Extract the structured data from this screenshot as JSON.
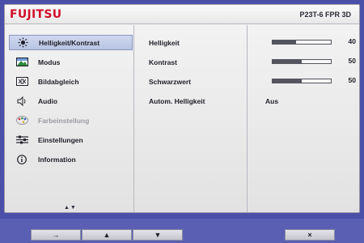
{
  "header": {
    "logo": "FUJITSU",
    "model": "P23T-6 FPR 3D"
  },
  "menu": {
    "items": [
      {
        "label": "Helligkeit/Kontrast",
        "icon": "sun-icon",
        "selected": true,
        "disabled": false
      },
      {
        "label": "Modus",
        "icon": "picture-mode-icon",
        "selected": false,
        "disabled": false
      },
      {
        "label": "Bildabgleich",
        "icon": "image-adjust-icon",
        "selected": false,
        "disabled": false
      },
      {
        "label": "Audio",
        "icon": "speaker-icon",
        "selected": false,
        "disabled": false
      },
      {
        "label": "Farbeinstellung",
        "icon": "palette-icon",
        "selected": false,
        "disabled": true
      },
      {
        "label": "Einstellungen",
        "icon": "settings-sliders-icon",
        "selected": false,
        "disabled": false
      },
      {
        "label": "Information",
        "icon": "info-icon",
        "selected": false,
        "disabled": false
      }
    ],
    "scroll_indicator": "▲▼"
  },
  "settings": [
    {
      "label": "Helligkeit",
      "type": "slider",
      "value": 40,
      "value_text": "40"
    },
    {
      "label": "Kontrast",
      "type": "slider",
      "value": 50,
      "value_text": "50"
    },
    {
      "label": "Schwarzwert",
      "type": "slider",
      "value": 50,
      "value_text": "50"
    },
    {
      "label": "Autom. Helligkeit",
      "type": "text",
      "value_text": "Aus"
    }
  ],
  "buttons": [
    {
      "label": "→",
      "name": "enter-button"
    },
    {
      "label": "▲",
      "name": "up-button"
    },
    {
      "label": "▼",
      "name": "down-button"
    },
    {
      "label": "×",
      "name": "exit-button"
    }
  ],
  "colors": {
    "logo": "#d0102a",
    "selection": "#c4cde8",
    "background": "#4a4fa8"
  }
}
